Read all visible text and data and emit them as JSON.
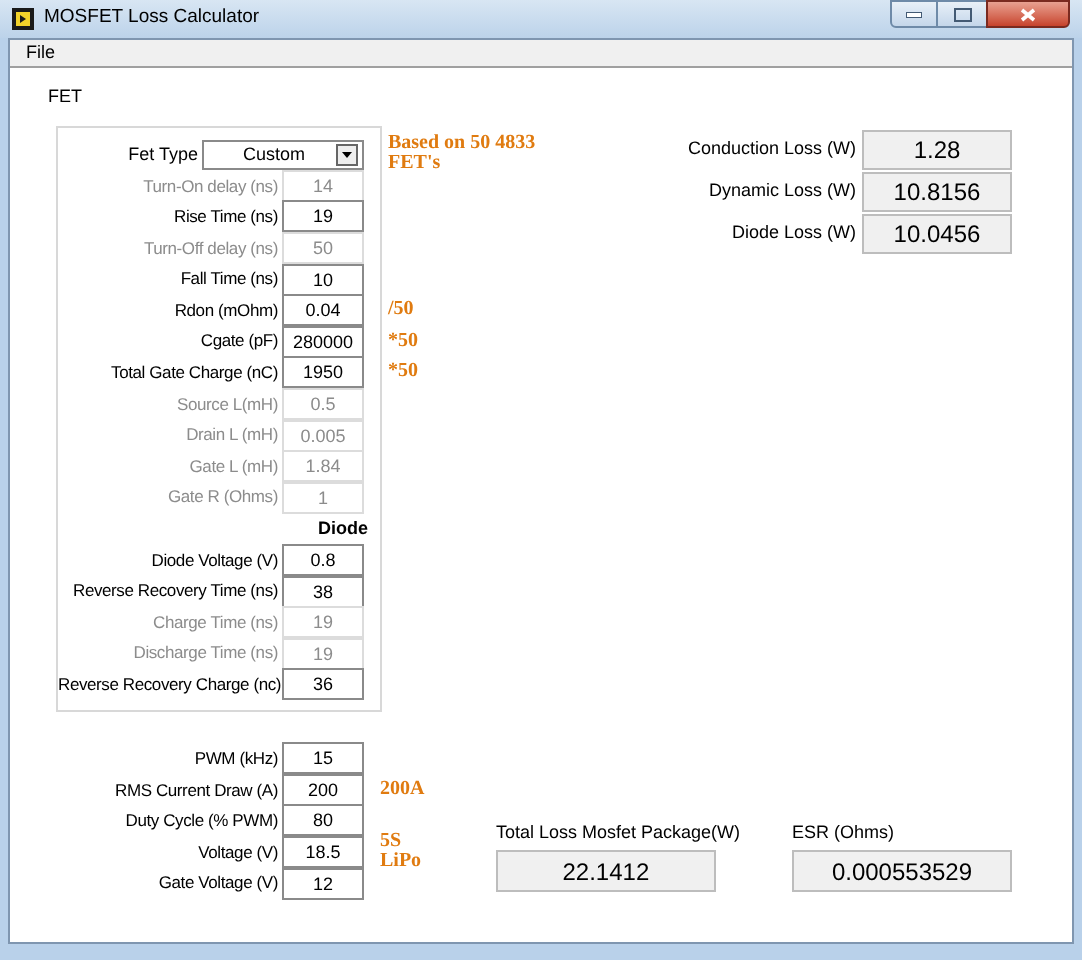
{
  "window": {
    "title": "MOSFET Loss Calculator"
  },
  "menu": [
    "File"
  ],
  "fet_panel": {
    "title": "FET",
    "rows": [
      {
        "kind": "dropdown",
        "label": "Fet Type",
        "value": "Custom",
        "note": [
          "Based on 50 4833",
          "FET's"
        ]
      },
      {
        "kind": "field",
        "label": "Turn-On delay (ns)",
        "value": "14",
        "disabled": true
      },
      {
        "kind": "field",
        "label": "Rise Time (ns)",
        "value": "19",
        "disabled": false
      },
      {
        "kind": "field",
        "label": "Turn-Off delay (ns)",
        "value": "50",
        "disabled": true
      },
      {
        "kind": "field",
        "label": "Fall Time (ns)",
        "value": "10",
        "disabled": false
      },
      {
        "kind": "field",
        "label": "Rdon (mOhm)",
        "value": "0.04",
        "disabled": false,
        "note": [
          "/50"
        ]
      },
      {
        "kind": "field",
        "label": "Cgate (pF)",
        "value": "280000",
        "disabled": false,
        "note": [
          "*50"
        ]
      },
      {
        "kind": "field",
        "label": "Total Gate Charge (nC)",
        "value": "1950",
        "disabled": false,
        "note": [
          "*50"
        ]
      },
      {
        "kind": "field",
        "label": "Source L(mH)",
        "value": "0.5",
        "disabled": true
      },
      {
        "kind": "field",
        "label": "Drain L (mH)",
        "value": "0.005",
        "disabled": true
      },
      {
        "kind": "field",
        "label": "Gate L (mH)",
        "value": "1.84",
        "disabled": true
      },
      {
        "kind": "field",
        "label": "Gate R (Ohms)",
        "value": "1",
        "disabled": true
      },
      {
        "kind": "heading",
        "label": "Diode"
      },
      {
        "kind": "field",
        "label": "Diode Voltage (V)",
        "value": "0.8",
        "disabled": false
      },
      {
        "kind": "field",
        "label": "Reverse Recovery Time (ns)",
        "value": "38",
        "disabled": false
      },
      {
        "kind": "field",
        "label": "Charge Time (ns)",
        "value": "19",
        "disabled": true
      },
      {
        "kind": "field",
        "label": "Discharge Time (ns)",
        "value": "19",
        "disabled": true
      },
      {
        "kind": "field",
        "label": "Reverse Recovery Charge (nc)",
        "value": "36",
        "disabled": false
      }
    ]
  },
  "results": [
    {
      "label": "Conduction Loss (W)",
      "value": "1.28"
    },
    {
      "label": "Dynamic Loss (W)",
      "value": "10.8156"
    },
    {
      "label": "Diode Loss (W)",
      "value": "10.0456"
    }
  ],
  "operating": [
    {
      "label": "PWM (kHz)",
      "value": "15"
    },
    {
      "label": "RMS Current Draw (A)",
      "value": "200",
      "note": [
        "200A"
      ]
    },
    {
      "label": "Duty Cycle (% PWM)",
      "value": "80"
    },
    {
      "label": "Voltage (V)",
      "value": "18.5",
      "note": [
        "5S",
        "LiPo"
      ]
    },
    {
      "label": "Gate Voltage (V)",
      "value": "12"
    }
  ],
  "totals": [
    {
      "label": "Total Loss Mosfet Package(W)",
      "value": "22.1412"
    },
    {
      "label": "ESR (Ohms)",
      "value": "0.000553529"
    }
  ]
}
